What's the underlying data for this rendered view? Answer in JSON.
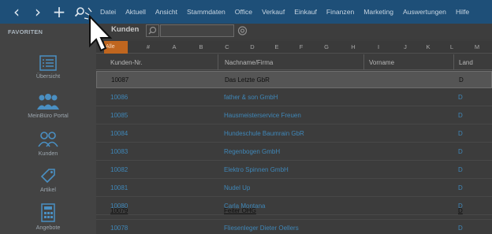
{
  "topbar": {
    "menu": [
      "Datei",
      "Aktuell",
      "Ansicht",
      "Stammdaten",
      "Office",
      "Verkauf",
      "Einkauf",
      "Finanzen",
      "Marketing",
      "Auswertungen",
      "Hilfe"
    ]
  },
  "sidebar": {
    "favorites_label": "FAVORITEN",
    "items": [
      {
        "label": "Übersicht",
        "icon": "overview-icon"
      },
      {
        "label": "MeinBüro Portal",
        "icon": "portal-icon"
      },
      {
        "label": "Kunden",
        "icon": "customers-icon"
      },
      {
        "label": "Artikel",
        "icon": "article-tag-icon"
      },
      {
        "label": "Angebote",
        "icon": "calculator-icon"
      }
    ]
  },
  "header": {
    "title": "Kunden",
    "orange_tab": "Alle"
  },
  "letters": [
    "#",
    "A",
    "B",
    "C",
    "D",
    "E",
    "F",
    "G",
    "H",
    "I",
    "J",
    "K",
    "L",
    "M"
  ],
  "table": {
    "columns": [
      "Kunden-Nr.",
      "Nachname/Firma",
      "Vorname",
      "Land"
    ],
    "rows": [
      {
        "nr": "10087",
        "name": "Das Letzte GbR",
        "vorname": "",
        "land": "D"
      },
      {
        "nr": "10086",
        "name": "father & son GmbH",
        "vorname": "",
        "land": "D"
      },
      {
        "nr": "10085",
        "name": "Hausmeisterservice Freuen",
        "vorname": "",
        "land": "D"
      },
      {
        "nr": "10084",
        "name": "Hundeschule Baumrain GbR",
        "vorname": "",
        "land": "D"
      },
      {
        "nr": "10083",
        "name": "Regenbogen GmbH",
        "vorname": "",
        "land": "D"
      },
      {
        "nr": "10082",
        "name": "Elektro Spinnen GmbH",
        "vorname": "",
        "land": "D"
      },
      {
        "nr": "10081",
        "name": "Nudel Up",
        "vorname": "",
        "land": "D"
      },
      {
        "nr": "10080",
        "name": "Carla Montana",
        "vorname": "",
        "land": "D"
      },
      {
        "nr": "10079",
        "name": "Feiter OHG",
        "vorname": "",
        "land": "D"
      },
      {
        "nr": "10078",
        "name": "Fliesenleger Dieter Oellers",
        "vorname": "",
        "land": "D"
      }
    ]
  },
  "colors": {
    "topbar": "#1e4f78",
    "link_blue": "#3f87b8",
    "orange": "#c0661f",
    "overlay_dark": "#3c3c3c"
  }
}
